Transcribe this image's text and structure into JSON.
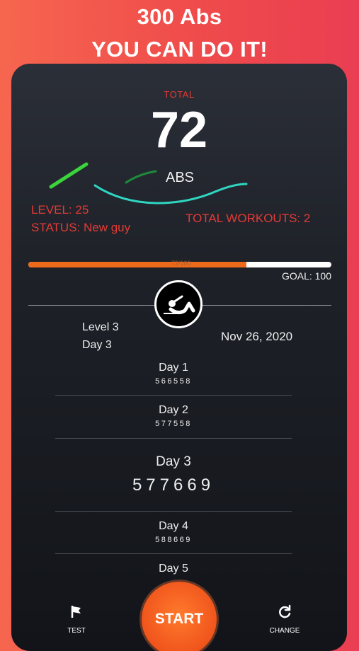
{
  "headline": {
    "line1": "300 Abs",
    "line2": "YOU CAN DO IT!"
  },
  "stats": {
    "total_label": "TOTAL",
    "total_value": "72",
    "unit": "ABS",
    "level": "LEVEL: 25",
    "status": "STATUS: New guy",
    "total_workouts": "TOTAL WORKOUTS: 2"
  },
  "progress": {
    "value": 72,
    "goal_value": 100,
    "text": "72/100",
    "goal": "GOAL: 100"
  },
  "plan": {
    "level": "Level 3",
    "day": "Day 3",
    "date": "Nov 26, 2020"
  },
  "days": [
    {
      "name": "Day 1",
      "reps": "566558"
    },
    {
      "name": "Day 2",
      "reps": "577558"
    },
    {
      "name": "Day 3",
      "reps": "577669"
    },
    {
      "name": "Day 4",
      "reps": "588669"
    },
    {
      "name": "Day 5",
      "reps": ""
    }
  ],
  "bottom_nav": {
    "test": "TEST",
    "start": "START",
    "change": "CHANGE"
  },
  "colors": {
    "accent_red": "#e33b35",
    "progress_orange": "#ee6a1b",
    "wave_cyan": "#2fd6c2",
    "wave_green": "#3bd43b"
  },
  "icons": {
    "emblem": "situp-icon",
    "test": "flag-icon",
    "change": "refresh-icon"
  }
}
